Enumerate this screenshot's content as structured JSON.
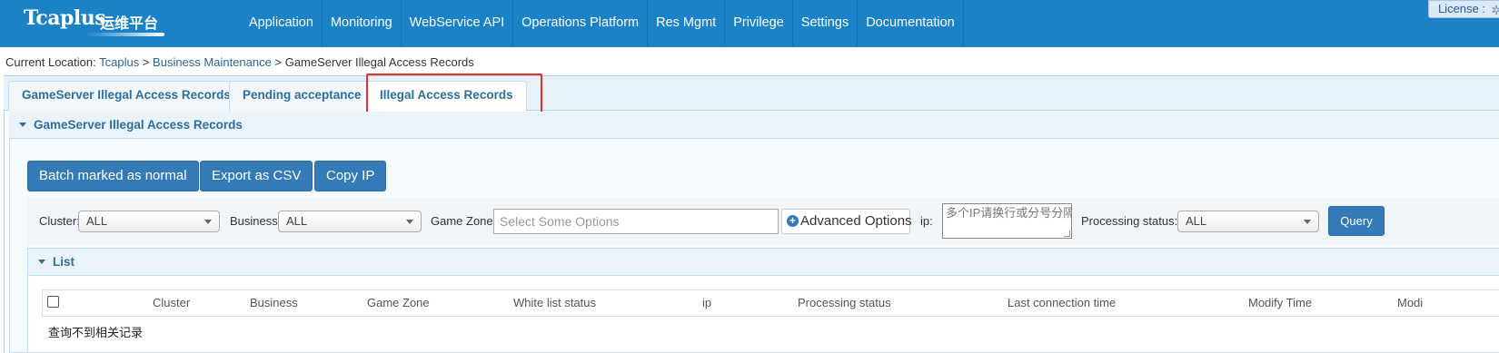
{
  "brand": {
    "name": "Tcaplus",
    "subtitle": "运维平台"
  },
  "nav": [
    "Application",
    "Monitoring",
    "WebService API",
    "Operations Platform",
    "Res Mgmt",
    "Privilege",
    "Settings",
    "Documentation"
  ],
  "license": "License :",
  "breadcrumb": {
    "prefix": "Current Location:",
    "items": [
      "Tcaplus",
      "Business Maintenance",
      "GameServer Illegal Access Records"
    ],
    "separator": ">"
  },
  "tabs": [
    "GameServer Illegal Access Records",
    "Pending acceptance",
    "Illegal Access Records"
  ],
  "active_tab": "Illegal Access Records",
  "panel_title": "GameServer Illegal Access Records",
  "actions": {
    "batch": "Batch marked as normal",
    "export": "Export as CSV",
    "copy_ip": "Copy IP"
  },
  "filters": {
    "cluster_label": "Cluster:",
    "cluster_value": "ALL",
    "business_label": "Business:",
    "business_value": "ALL",
    "zone_label": "Game Zone:",
    "zone_placeholder": "Select Some Options",
    "advanced": "Advanced Options",
    "ip_label": "ip:",
    "ip_placeholder": "多个IP请换行或分号分隔",
    "status_label": "Processing status:",
    "status_value": "ALL",
    "query": "Query"
  },
  "list": {
    "title": "List",
    "columns": [
      "Cluster",
      "Business",
      "Game Zone",
      "White list status",
      "ip",
      "Processing status",
      "Last connection time",
      "Modify Time",
      "Modi"
    ],
    "empty_text": "查询不到相关记录"
  },
  "colors": {
    "nav_bg": "#1b82c7",
    "primary_button": "#337ab7",
    "highlight": "#e8302a",
    "tab_text": "#2e6e9e"
  }
}
